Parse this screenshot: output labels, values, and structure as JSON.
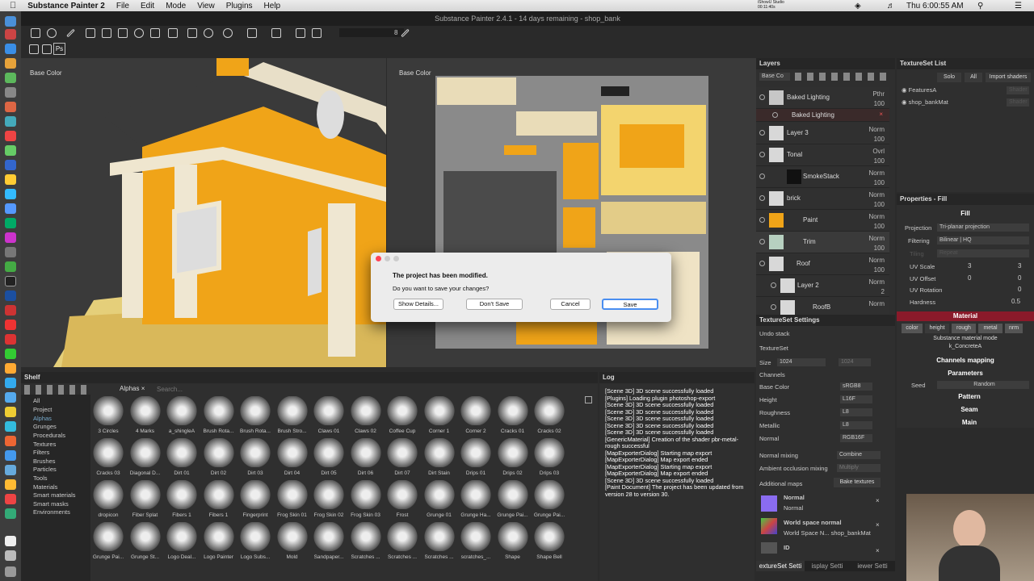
{
  "menubar": {
    "app": "Substance Painter 2",
    "items": [
      "File",
      "Edit",
      "Mode",
      "View",
      "Plugins",
      "Help"
    ],
    "studio": "iShowU Studio",
    "rec_time": "00:11:40s",
    "clock": "Thu 6:00:55 AM"
  },
  "window": {
    "title": "Substance Painter 2.4.1 - 14 days remaining - shop_bank"
  },
  "toolbar": {
    "value": "8",
    "ps": "Ps"
  },
  "viewport3d": {
    "label": "Base Color"
  },
  "viewport2d": {
    "label": "Base Color"
  },
  "layers": {
    "title": "Layers",
    "channel": "Base Co",
    "items": [
      {
        "name": "Baked Lighting",
        "blend": "Pthr",
        "op": "100"
      },
      {
        "name": "Baked Lighting",
        "blend": "",
        "op": ""
      },
      {
        "name": "Layer 3",
        "blend": "Norm",
        "op": "100"
      },
      {
        "name": "Tonal",
        "blend": "Ovrl",
        "op": "100"
      },
      {
        "name": "SmokeStack",
        "blend": "Norm",
        "op": "100"
      },
      {
        "name": "brick",
        "blend": "Norm",
        "op": "100"
      },
      {
        "name": "Paint",
        "blend": "Norm",
        "op": "100"
      },
      {
        "name": "Trim",
        "blend": "Norm",
        "op": "100"
      },
      {
        "name": "Roof",
        "blend": "Norm",
        "op": "100"
      },
      {
        "name": "Layer 2",
        "blend": "Norm",
        "op": "2"
      },
      {
        "name": "RoofB",
        "blend": "Norm",
        "op": ""
      }
    ]
  },
  "texset_list": {
    "title": "TextureSet List",
    "solo": "Solo",
    "all": "All",
    "import": "Import shaders",
    "sets": [
      "FeaturesA",
      "shop_bankMat"
    ],
    "shader": "Shader"
  },
  "props": {
    "title": "Properties - Fill",
    "fill": "Fill",
    "projection_label": "Projection",
    "projection": "Tri-planar projection",
    "filtering_label": "Filtering",
    "filtering": "Bilinear | HQ",
    "tiling_label": "Tiling",
    "tiling": "Repeat",
    "uvscale_label": "UV Scale",
    "uvscale": "3",
    "uvscale2": "3",
    "uvoffset_label": "UV Offset",
    "uvoffset": "0",
    "uvoffset2": "0",
    "uvrot_label": "UV Rotation",
    "uvrot": "0",
    "hardness_label": "Hardness",
    "hardness": "0.5",
    "material": "Material",
    "chans": [
      "color",
      "height",
      "rough",
      "metal",
      "nrm"
    ],
    "matmode": "Substance material mode",
    "matname": "k_ConcreteA",
    "chmap": "Channels mapping",
    "params": "Parameters",
    "seed_label": "Seed",
    "seed": "Random",
    "pattern": "Pattern",
    "seam": "Seam",
    "main": "Main"
  },
  "tsset": {
    "title": "TextureSet Settings",
    "undo": "Undo stack",
    "texset": "TextureSet",
    "size_label": "Size",
    "size": "1024",
    "size2": "1024",
    "channels_label": "Channels",
    "channels": [
      {
        "n": "Base Color",
        "f": "sRGB8"
      },
      {
        "n": "Height",
        "f": "L16F"
      },
      {
        "n": "Roughness",
        "f": "L8"
      },
      {
        "n": "Metallic",
        "f": "L8"
      },
      {
        "n": "Normal",
        "f": "RGB16F"
      }
    ],
    "nmix_label": "Normal mixing",
    "nmix": "Combine",
    "ao_label": "Ambient occlusion mixing",
    "ao": "Multiply",
    "addmaps": "Additional maps",
    "bake": "Bake textures",
    "maps": [
      {
        "t": "Normal",
        "s": "Normal"
      },
      {
        "t": "World space normal",
        "s": "World Space N... shop_bankMat"
      },
      {
        "t": "ID",
        "s": ""
      }
    ],
    "tabs": [
      "extureSet Setti",
      "isplay Setti",
      "iewer Setti"
    ]
  },
  "shelf": {
    "title": "Shelf",
    "tab": "Alphas",
    "search": "Search...",
    "cats": [
      "All",
      "Project",
      "Alphas",
      "Grunges",
      "Procedurals",
      "Textures",
      "Filters",
      "Brushes",
      "Particles",
      "Tools",
      "Materials",
      "Smart materials",
      "Smart masks",
      "Environments"
    ],
    "items": [
      "3 Circles",
      "4 Marks",
      "a_shingleA",
      "Brush Rota...",
      "Brush Rota...",
      "Brush Stro...",
      "Claws 01",
      "Claws 02",
      "Coffee Cup",
      "Corner 1",
      "Corner 2",
      "Cracks 01",
      "Cracks 02",
      "Cracks 03",
      "Diagonal D...",
      "Dirt 01",
      "Dirt 02",
      "Dirt 03",
      "Dirt 04",
      "Dirt 05",
      "Dirt 06",
      "Dirt 07",
      "Dirt Stain",
      "Drips 01",
      "Drips 02",
      "Drips 03",
      "dropicon",
      "Fiber Splat",
      "Fibers 1",
      "Fibers 1",
      "Fingerprint",
      "Frog Skin 01",
      "Frog Skin 02",
      "Frog Skin 03",
      "Frost",
      "Grunge 01",
      "Grunge Ha...",
      "Grunge Pai...",
      "Grunge Pai...",
      "Grunge Pai...",
      "Grunge St...",
      "Logo Deal...",
      "Logo Painter",
      "Logo Subs...",
      "Mold",
      "Sandpaper...",
      "Scratches ...",
      "Scratches ...",
      "Scratches ...",
      "scratches_...",
      "Shape",
      "Shape Bell"
    ]
  },
  "log": {
    "title": "Log",
    "text": "[Scene 3D] 3D scene successfully loaded\n[Plugins] Loading plugin photoshop-export\n[Scene 3D] 3D scene successfully loaded\n[Scene 3D] 3D scene successfully loaded\n[Scene 3D] 3D scene successfully loaded\n[Scene 3D] 3D scene successfully loaded\n[Scene 3D] 3D scene successfully loaded\n[GenericMaterial] Creation of the shader pbr-metal-rough successful\n[MapExporterDialog] Starting map export\n[MapExporterDialog] Map export ended\n[MapExporterDialog] Starting map export\n[MapExporterDialog] Map export ended\n[Scene 3D] 3D scene successfully loaded\n[Paint Document] The project has been updated from version 28 to version 30."
  },
  "dialog": {
    "title": "The project has been modified.",
    "question": "Do you want to save your changes?",
    "details": "Show Details...",
    "dont": "Don't Save",
    "cancel": "Cancel",
    "save": "Save"
  }
}
